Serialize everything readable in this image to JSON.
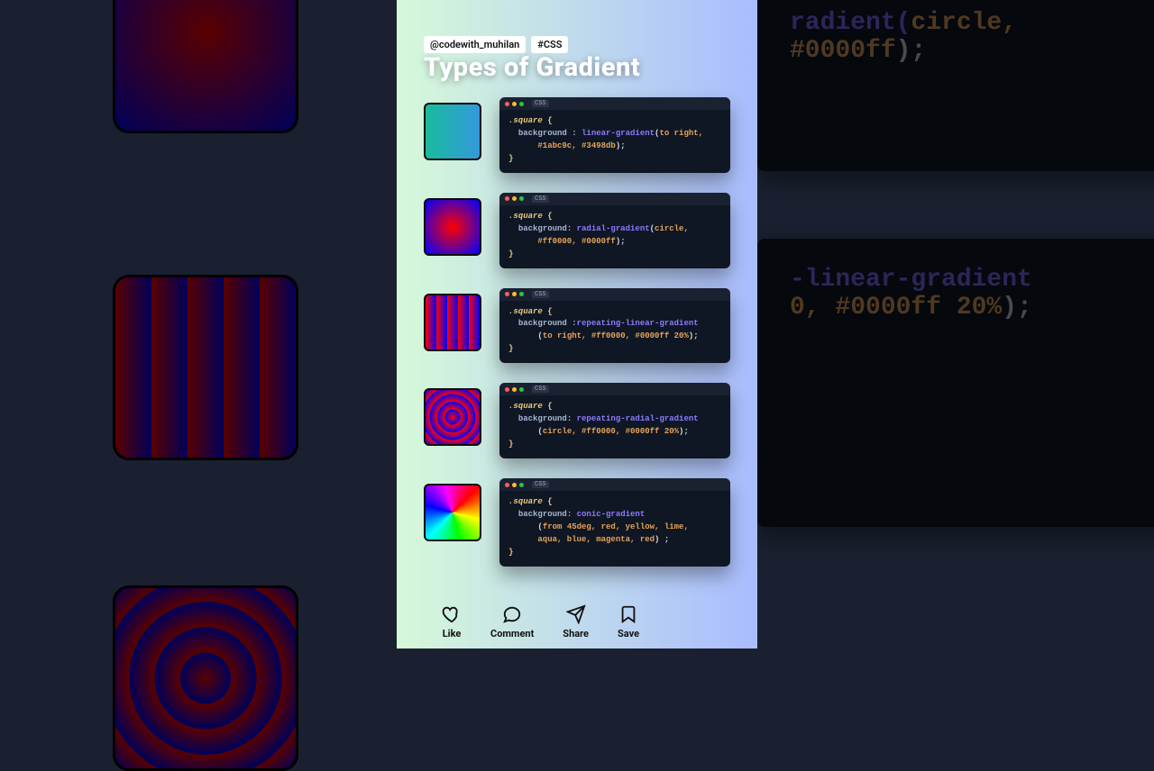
{
  "meta": {
    "handle": "@codewith_muhilan",
    "hashtag": "#CSS",
    "title": "Types of Gradient",
    "lang_label": "CSS"
  },
  "snippets": [
    {
      "swatch_class": "sw-linear",
      "lines": [
        {
          "indent": 0,
          "parts": [
            {
              "c": "sel",
              "t": ".square "
            },
            {
              "c": "br",
              "t": "{"
            }
          ]
        },
        {
          "indent": 1,
          "parts": [
            {
              "c": "prop",
              "t": "background : "
            },
            {
              "c": "fn",
              "t": "linear-gradient"
            },
            {
              "c": "pn",
              "t": "("
            },
            {
              "c": "kw",
              "t": "to right,"
            }
          ]
        },
        {
          "indent": 3,
          "parts": [
            {
              "c": "kw",
              "t": "#1abc9c, #3498db"
            },
            {
              "c": "pn",
              "t": ");"
            }
          ]
        },
        {
          "indent": 0,
          "parts": [
            {
              "c": "br",
              "t": "}"
            }
          ]
        }
      ]
    },
    {
      "swatch_class": "sw-radial",
      "lines": [
        {
          "indent": 0,
          "parts": [
            {
              "c": "sel",
              "t": ".square "
            },
            {
              "c": "br",
              "t": "{"
            }
          ]
        },
        {
          "indent": 1,
          "parts": [
            {
              "c": "prop",
              "t": "background: "
            },
            {
              "c": "fn",
              "t": "radial-gradient"
            },
            {
              "c": "pn",
              "t": "("
            },
            {
              "c": "kw",
              "t": "circle,"
            }
          ]
        },
        {
          "indent": 3,
          "parts": [
            {
              "c": "kw",
              "t": "#ff0000, #0000ff"
            },
            {
              "c": "pn",
              "t": ");"
            }
          ]
        },
        {
          "indent": 0,
          "parts": [
            {
              "c": "br",
              "t": "}"
            }
          ]
        }
      ]
    },
    {
      "swatch_class": "sw-rlin",
      "lines": [
        {
          "indent": 0,
          "parts": [
            {
              "c": "sel",
              "t": ".square "
            },
            {
              "c": "br",
              "t": "{"
            }
          ]
        },
        {
          "indent": 1,
          "parts": [
            {
              "c": "prop",
              "t": "background :"
            },
            {
              "c": "fn",
              "t": "repeating-linear-gradient"
            }
          ]
        },
        {
          "indent": 3,
          "parts": [
            {
              "c": "pn",
              "t": "("
            },
            {
              "c": "kw",
              "t": "to right, #ff0000, #0000ff 20%"
            },
            {
              "c": "pn",
              "t": ");"
            }
          ]
        },
        {
          "indent": 0,
          "parts": [
            {
              "c": "br",
              "t": "}"
            }
          ]
        }
      ]
    },
    {
      "swatch_class": "sw-rrad",
      "lines": [
        {
          "indent": 0,
          "parts": [
            {
              "c": "sel",
              "t": ".square "
            },
            {
              "c": "br",
              "t": "{"
            }
          ]
        },
        {
          "indent": 1,
          "parts": [
            {
              "c": "prop",
              "t": "background: "
            },
            {
              "c": "fn",
              "t": "repeating-radial-gradient"
            }
          ]
        },
        {
          "indent": 3,
          "parts": [
            {
              "c": "pn",
              "t": "("
            },
            {
              "c": "kw",
              "t": "circle, #ff0000, #0000ff 20%"
            },
            {
              "c": "pn",
              "t": ");"
            }
          ]
        },
        {
          "indent": 0,
          "parts": [
            {
              "c": "br",
              "t": "}"
            }
          ]
        }
      ]
    },
    {
      "swatch_class": "sw-conic",
      "lines": [
        {
          "indent": 0,
          "parts": [
            {
              "c": "sel",
              "t": ".square "
            },
            {
              "c": "br",
              "t": "{"
            }
          ]
        },
        {
          "indent": 1,
          "parts": [
            {
              "c": "prop",
              "t": "background: "
            },
            {
              "c": "fn",
              "t": "conic-gradient"
            }
          ]
        },
        {
          "indent": 3,
          "parts": [
            {
              "c": "pn",
              "t": "("
            },
            {
              "c": "kw",
              "t": "from 45deg, red, yellow, lime,"
            }
          ]
        },
        {
          "indent": 3,
          "parts": [
            {
              "c": "kw",
              "t": "aqua, blue, magenta, red"
            },
            {
              "c": "pn",
              "t": ") ;"
            }
          ]
        },
        {
          "indent": 0,
          "parts": [
            {
              "c": "br",
              "t": "}"
            }
          ]
        }
      ]
    }
  ],
  "actions": {
    "like": "Like",
    "comment": "Comment",
    "share": "Share",
    "save": "Save"
  },
  "bg_right": {
    "line1a": "radient(",
    "line1b": "circle,",
    "line2a": "#0000ff",
    "line2b": ");",
    "line3": "-linear-gradient",
    "line4a": "0, #0000ff 20%",
    "line4b": ");"
  }
}
